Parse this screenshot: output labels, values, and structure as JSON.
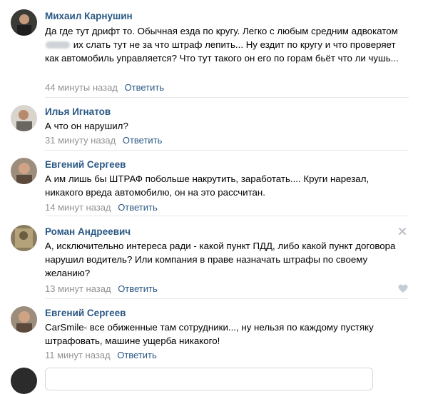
{
  "comments": [
    {
      "author": "Михаил Карнушин",
      "text_a": "Да где тут дрифт то. Обычная езда по кругу. Легко с любым средним адвокатом",
      "text_b": "их слать тут не за что штраф лепить... Ну ездит по кругу и что проверяет как автомобиль управляется? Что тут такого он его по горам бьёт что ли чушь...",
      "time": "44 минуты назад",
      "reply": "Ответить"
    },
    {
      "author": "Илья Игнатов",
      "text": "А что он нарушил?",
      "time": "31 минуту назад",
      "reply": "Ответить"
    },
    {
      "author": "Евгений Сергеев",
      "text": "А им лишь бы ШТРАФ побольше накрутить, заработать.... Круги нарезал, никакого вреда автомобилю, он на это рассчитан.",
      "time": "14 минут назад",
      "reply": "Ответить"
    },
    {
      "author": "Роман Андреевич",
      "text": "А, исключительно интереса ради - какой пункт ПДД, либо какой пункт договора нарушил водитель? Или компания в праве назначать штрафы по своему желанию?",
      "time": "13 минут назад",
      "reply": "Ответить"
    },
    {
      "author": "Евгений Сергеев",
      "text": "CarSmile- все обиженные там сотрудники..., ну нельзя по каждому пустяку штрафовать, машине ущерба никакого!",
      "time": "11 минут назад",
      "reply": "Ответить"
    }
  ],
  "colors": {
    "link": "#2a5885",
    "muted": "#939393",
    "separator": "#e7e8ec"
  }
}
